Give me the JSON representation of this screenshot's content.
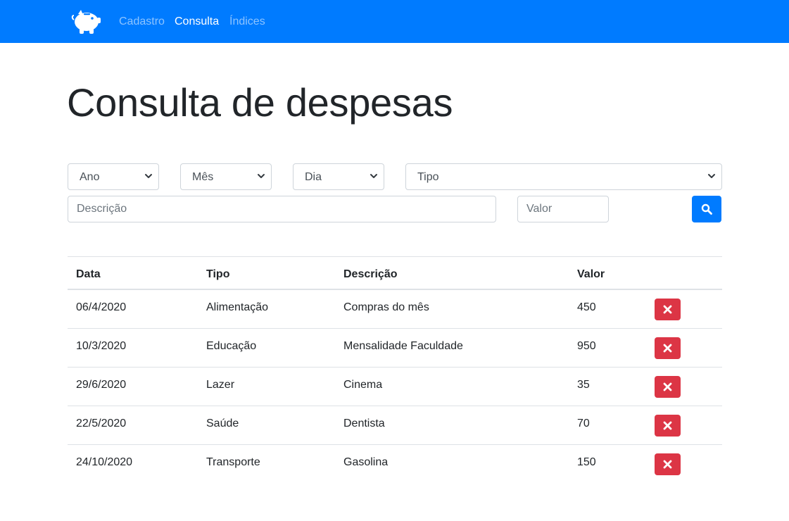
{
  "navbar": {
    "brand_icon": "piggy-bank-icon",
    "links": [
      {
        "label": "Cadastro",
        "active": false
      },
      {
        "label": "Consulta",
        "active": true
      },
      {
        "label": "Índices",
        "active": false
      }
    ],
    "color": "#007bff"
  },
  "page": {
    "title": "Consulta de despesas"
  },
  "filters": {
    "ano": "Ano",
    "mes": "Mês",
    "dia": "Dia",
    "tipo": "Tipo",
    "descricao_placeholder": "Descrição",
    "valor_placeholder": "Valor",
    "search_icon": "search-icon"
  },
  "table": {
    "headers": {
      "data": "Data",
      "tipo": "Tipo",
      "descricao": "Descrição",
      "valor": "Valor"
    },
    "rows": [
      {
        "data": "06/4/2020",
        "tipo": "Alimentação",
        "descricao": "Compras do mês",
        "valor": "450"
      },
      {
        "data": "10/3/2020",
        "tipo": "Educação",
        "descricao": "Mensalidade Faculdade",
        "valor": "950"
      },
      {
        "data": "29/6/2020",
        "tipo": "Lazer",
        "descricao": "Cinema",
        "valor": "35"
      },
      {
        "data": "22/5/2020",
        "tipo": "Saúde",
        "descricao": "Dentista",
        "valor": "70"
      },
      {
        "data": "24/10/2020",
        "tipo": "Transporte",
        "descricao": "Gasolina",
        "valor": "150"
      }
    ],
    "delete_icon": "times-icon",
    "delete_color": "#dc3545"
  }
}
